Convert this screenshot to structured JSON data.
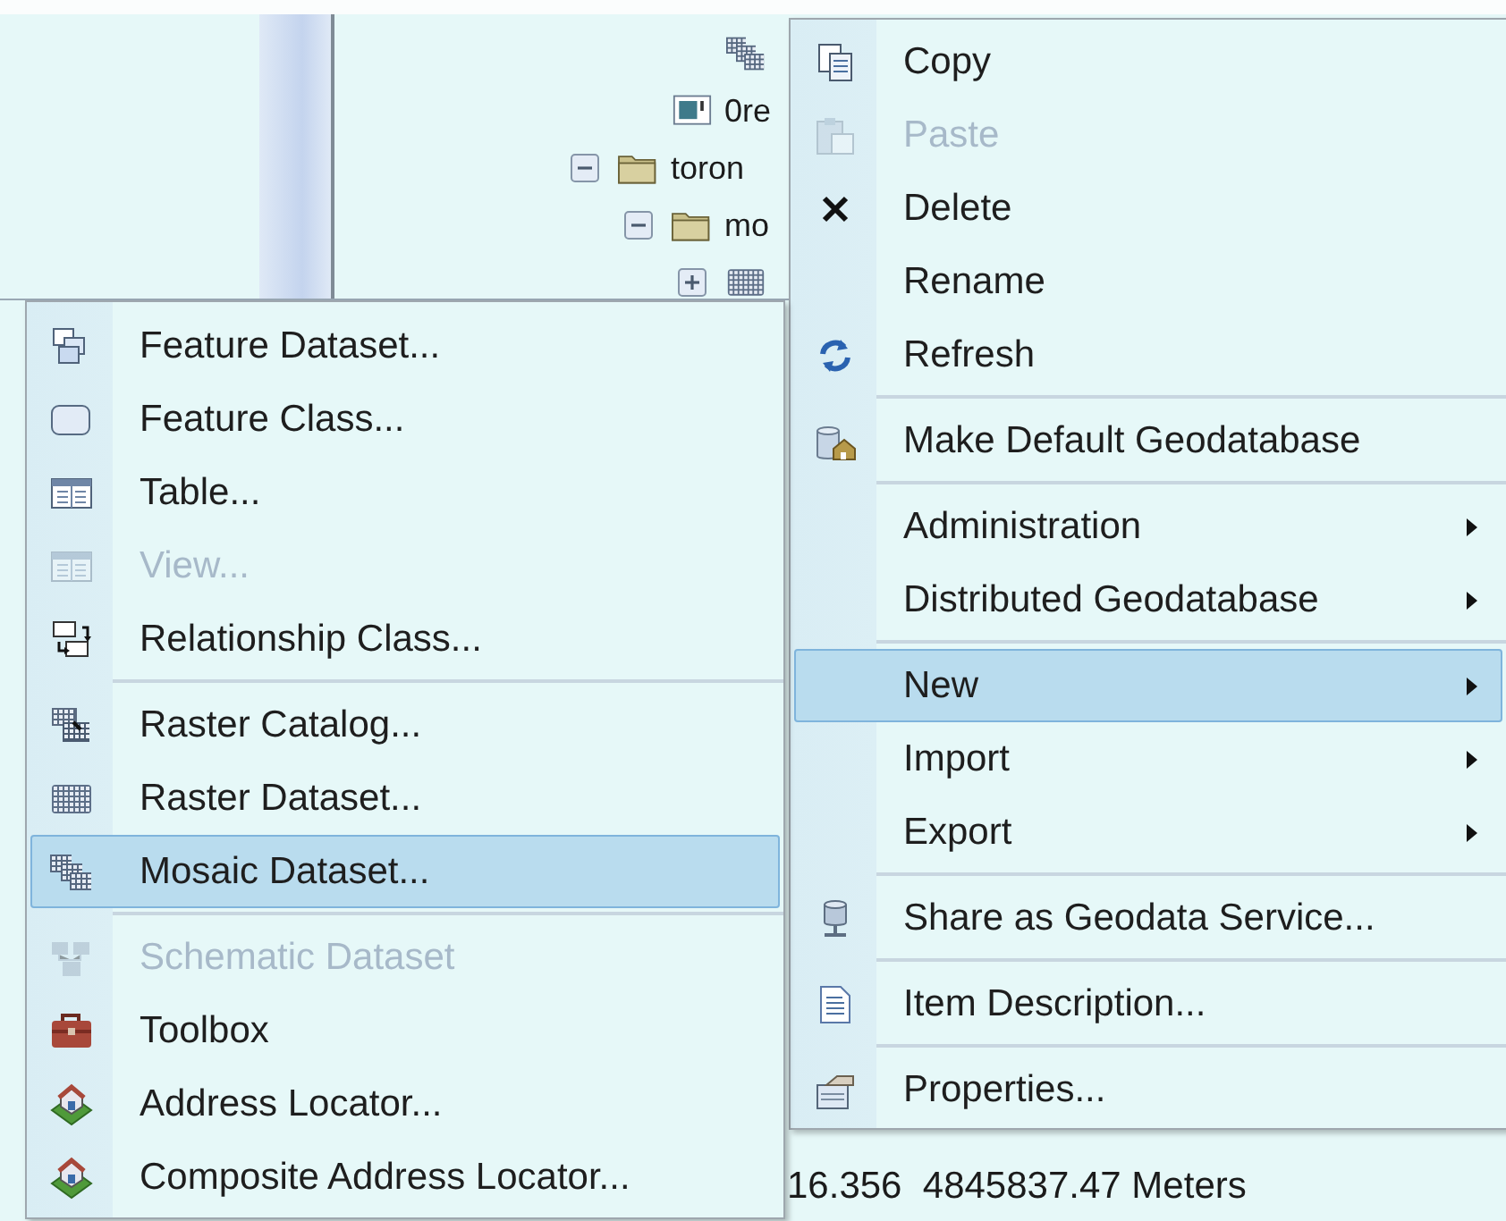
{
  "tree": [
    {
      "children": [
        {
          "children": [
            {
              "kind": "mosaic"
            }
          ]
        },
        {
          "kind": "image",
          "label": "0re"
        }
      ]
    },
    {
      "kind": "folder",
      "label": "toron",
      "expanded": true,
      "children": [
        {
          "kind": "folder",
          "label": "mo",
          "expanded": true,
          "children": [
            {
              "kind": "raster",
              "expanded": false
            }
          ]
        }
      ]
    }
  ],
  "context_menu": {
    "items": [
      {
        "kind": "item",
        "label": "Copy",
        "disabled": false,
        "selected": false,
        "submenu": false
      },
      {
        "kind": "item",
        "label": "Paste",
        "disabled": true,
        "selected": false,
        "submenu": false
      },
      {
        "kind": "item",
        "label": "Delete",
        "disabled": false,
        "selected": false,
        "submenu": false
      },
      {
        "kind": "item",
        "label": "Rename",
        "disabled": false,
        "selected": false,
        "submenu": false
      },
      {
        "kind": "item",
        "label": "Refresh",
        "disabled": false,
        "selected": false,
        "submenu": false
      },
      {
        "kind": "separator"
      },
      {
        "kind": "item",
        "label": "Make Default Geodatabase",
        "disabled": false,
        "selected": false,
        "submenu": false
      },
      {
        "kind": "separator"
      },
      {
        "kind": "item",
        "label": "Administration",
        "disabled": false,
        "selected": false,
        "submenu": true
      },
      {
        "kind": "item",
        "label": "Distributed Geodatabase",
        "disabled": false,
        "selected": false,
        "submenu": true
      },
      {
        "kind": "separator"
      },
      {
        "kind": "item",
        "label": "New",
        "disabled": false,
        "selected": true,
        "submenu": true
      },
      {
        "kind": "item",
        "label": "Import",
        "disabled": false,
        "selected": false,
        "submenu": true
      },
      {
        "kind": "item",
        "label": "Export",
        "disabled": false,
        "selected": false,
        "submenu": true
      },
      {
        "kind": "separator"
      },
      {
        "kind": "item",
        "label": "Share as Geodata Service...",
        "disabled": false,
        "selected": false,
        "submenu": false
      },
      {
        "kind": "separator"
      },
      {
        "kind": "item",
        "label": "Item Description...",
        "disabled": false,
        "selected": false,
        "submenu": false
      },
      {
        "kind": "separator"
      },
      {
        "kind": "item",
        "label": "Properties...",
        "disabled": false,
        "selected": false,
        "submenu": false
      }
    ]
  },
  "new_submenu": {
    "items": [
      {
        "kind": "item",
        "label": "Feature Dataset...",
        "disabled": false,
        "selected": false
      },
      {
        "kind": "item",
        "label": "Feature Class...",
        "disabled": false,
        "selected": false
      },
      {
        "kind": "item",
        "label": "Table...",
        "disabled": false,
        "selected": false
      },
      {
        "kind": "item",
        "label": "View...",
        "disabled": true,
        "selected": false
      },
      {
        "kind": "item",
        "label": "Relationship Class...",
        "disabled": false,
        "selected": false
      },
      {
        "kind": "separator"
      },
      {
        "kind": "item",
        "label": "Raster Catalog...",
        "disabled": false,
        "selected": false
      },
      {
        "kind": "item",
        "label": "Raster Dataset...",
        "disabled": false,
        "selected": false
      },
      {
        "kind": "item",
        "label": "Mosaic Dataset...",
        "disabled": false,
        "selected": true
      },
      {
        "kind": "separator"
      },
      {
        "kind": "item",
        "label": "Schematic Dataset",
        "disabled": true,
        "selected": false
      },
      {
        "kind": "item",
        "label": "Toolbox",
        "disabled": false,
        "selected": false
      },
      {
        "kind": "item",
        "label": "Address Locator...",
        "disabled": false,
        "selected": false
      },
      {
        "kind": "item",
        "label": "Composite Address Locator...",
        "disabled": false,
        "selected": false
      }
    ]
  },
  "status_bar": {
    "text": "16.356  4845837.47 Meters"
  }
}
